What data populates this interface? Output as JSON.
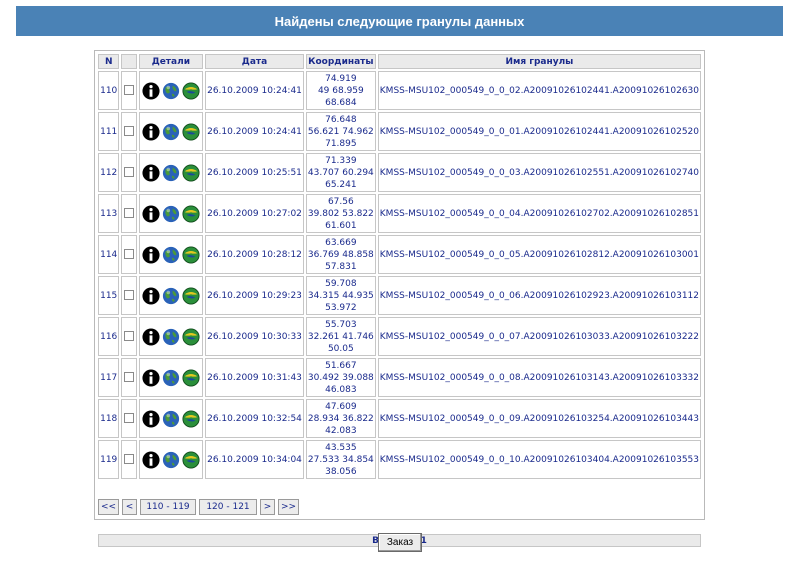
{
  "header": {
    "title": "Найдены следующие гранулы данных"
  },
  "table": {
    "columns": {
      "n": "N",
      "details": "Детали",
      "date": "Дата",
      "coords": "Координаты",
      "name": "Имя гранулы"
    },
    "rows": [
      {
        "n": "110",
        "date": "26.10.2009 10:24:41",
        "c1": "74.919",
        "c2": "49 68.959",
        "c3": "68.684",
        "name": "KMSS-MSU102_000549_0_0_02.A20091026102441.A20091026102630"
      },
      {
        "n": "111",
        "date": "26.10.2009 10:24:41",
        "c1": "76.648",
        "c2": "56.621 74.962",
        "c3": "71.895",
        "name": "KMSS-MSU102_000549_0_0_01.A20091026102441.A20091026102520"
      },
      {
        "n": "112",
        "date": "26.10.2009 10:25:51",
        "c1": "71.339",
        "c2": "43.707 60.294",
        "c3": "65.241",
        "name": "KMSS-MSU102_000549_0_0_03.A20091026102551.A20091026102740"
      },
      {
        "n": "113",
        "date": "26.10.2009 10:27:02",
        "c1": "67.56",
        "c2": "39.802 53.822",
        "c3": "61.601",
        "name": "KMSS-MSU102_000549_0_0_04.A20091026102702.A20091026102851"
      },
      {
        "n": "114",
        "date": "26.10.2009 10:28:12",
        "c1": "63.669",
        "c2": "36.769 48.858",
        "c3": "57.831",
        "name": "KMSS-MSU102_000549_0_0_05.A20091026102812.A20091026103001"
      },
      {
        "n": "115",
        "date": "26.10.2009 10:29:23",
        "c1": "59.708",
        "c2": "34.315 44.935",
        "c3": "53.972",
        "name": "KMSS-MSU102_000549_0_0_06.A20091026102923.A20091026103112"
      },
      {
        "n": "116",
        "date": "26.10.2009 10:30:33",
        "c1": "55.703",
        "c2": "32.261 41.746",
        "c3": "50.05",
        "name": "KMSS-MSU102_000549_0_0_07.A20091026103033.A20091026103222"
      },
      {
        "n": "117",
        "date": "26.10.2009 10:31:43",
        "c1": "51.667",
        "c2": "30.492 39.088",
        "c3": "46.083",
        "name": "KMSS-MSU102_000549_0_0_08.A20091026103143.A20091026103332"
      },
      {
        "n": "118",
        "date": "26.10.2009 10:32:54",
        "c1": "47.609",
        "c2": "28.934 36.822",
        "c3": "42.083",
        "name": "KMSS-MSU102_000549_0_0_09.A20091026103254.A20091026103443"
      },
      {
        "n": "119",
        "date": "26.10.2009 10:34:04",
        "c1": "43.535",
        "c2": "27.533 34.854",
        "c3": "38.056",
        "name": "KMSS-MSU102_000549_0_0_10.A20091026103404.A20091026103553"
      }
    ],
    "total": "Всего: 121"
  },
  "pager": {
    "first": "<<",
    "prev": "<",
    "page1": "110 - 119",
    "page2": "120 - 121",
    "next": ">",
    "last": ">>"
  },
  "order_button": "Заказ",
  "icons": [
    "info-icon",
    "globe-icon",
    "preview-globe-icon"
  ],
  "colors": {
    "title_bar": "#4a82b6",
    "text": "#1a2a8c",
    "header_bg": "#eaeaea"
  }
}
